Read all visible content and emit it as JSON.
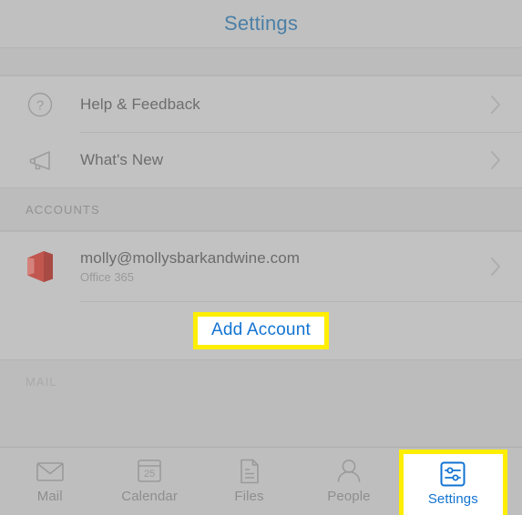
{
  "window": {
    "title": "Settings"
  },
  "help_group": {
    "items": [
      {
        "label": "Help & Feedback",
        "icon": "question-circle-icon",
        "chevron": "chevron-right-icon"
      },
      {
        "label": "What's New",
        "icon": "megaphone-icon",
        "chevron": "chevron-right-icon"
      }
    ]
  },
  "accounts_section": {
    "header": "ACCOUNTS",
    "account": {
      "email": "molly@mollysbarkandwine.com",
      "type": "Office 365",
      "icon": "office-365-icon",
      "chevron": "chevron-right-icon"
    },
    "add_account": {
      "label": "Add Account",
      "highlighted": true,
      "highlight_color": "#ffee00",
      "text_color": "#1273d2"
    }
  },
  "mail_section": {
    "header": "MAIL"
  },
  "tabbar": {
    "tabs": [
      {
        "label": "Mail",
        "icon": "envelope-icon",
        "active": false,
        "highlighted": false
      },
      {
        "label": "Calendar",
        "icon": "calendar-icon",
        "active": false,
        "highlighted": false,
        "day": "25"
      },
      {
        "label": "Files",
        "icon": "document-icon",
        "active": false,
        "highlighted": false
      },
      {
        "label": "People",
        "icon": "person-icon",
        "active": false,
        "highlighted": false
      },
      {
        "label": "Settings",
        "icon": "sliders-icon",
        "active": true,
        "highlighted": true
      }
    ]
  },
  "colors": {
    "background": "#c0c0c0",
    "accent_blue": "#1273d2",
    "title_blue": "#4b7fa6",
    "highlight_yellow": "#ffee00",
    "office_red": "#c1574f",
    "muted_text": "#6d6d6d",
    "subtle_text": "#9a9a9a"
  }
}
